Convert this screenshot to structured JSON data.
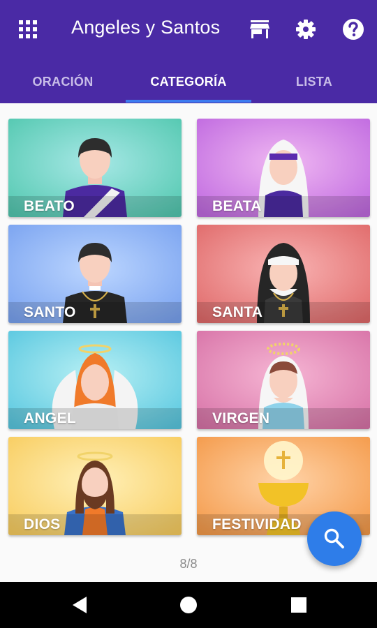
{
  "app": {
    "title": "Angeles y Santos",
    "menu_icon": "grid-menu-icon",
    "actions": [
      {
        "name": "store-icon"
      },
      {
        "name": "settings-gear-icon"
      },
      {
        "name": "help-icon"
      }
    ]
  },
  "tabs": [
    {
      "label": "ORACIÓN",
      "active": false
    },
    {
      "label": "CATEGORÍA",
      "active": true
    },
    {
      "label": "LISTA",
      "active": false
    }
  ],
  "colors": {
    "appbar": "#4a2aa5",
    "tab_indicator": "#3d7cf0",
    "fab": "#2e7de9"
  },
  "categories": [
    {
      "label": "BEATO",
      "icon": "beato-portrait-icon"
    },
    {
      "label": "BEATA",
      "icon": "beata-portrait-icon"
    },
    {
      "label": "SANTO",
      "icon": "santo-portrait-icon"
    },
    {
      "label": "SANTA",
      "icon": "santa-portrait-icon"
    },
    {
      "label": "ANGEL",
      "icon": "angel-portrait-icon"
    },
    {
      "label": "VIRGEN",
      "icon": "virgen-portrait-icon"
    },
    {
      "label": "DIOS",
      "icon": "dios-portrait-icon"
    },
    {
      "label": "FESTIVIDAD",
      "icon": "chalice-icon"
    }
  ],
  "page_indicator": "8/8",
  "fab": {
    "icon": "search-icon"
  },
  "system_nav": [
    {
      "name": "back-icon"
    },
    {
      "name": "home-icon"
    },
    {
      "name": "recents-icon"
    }
  ]
}
